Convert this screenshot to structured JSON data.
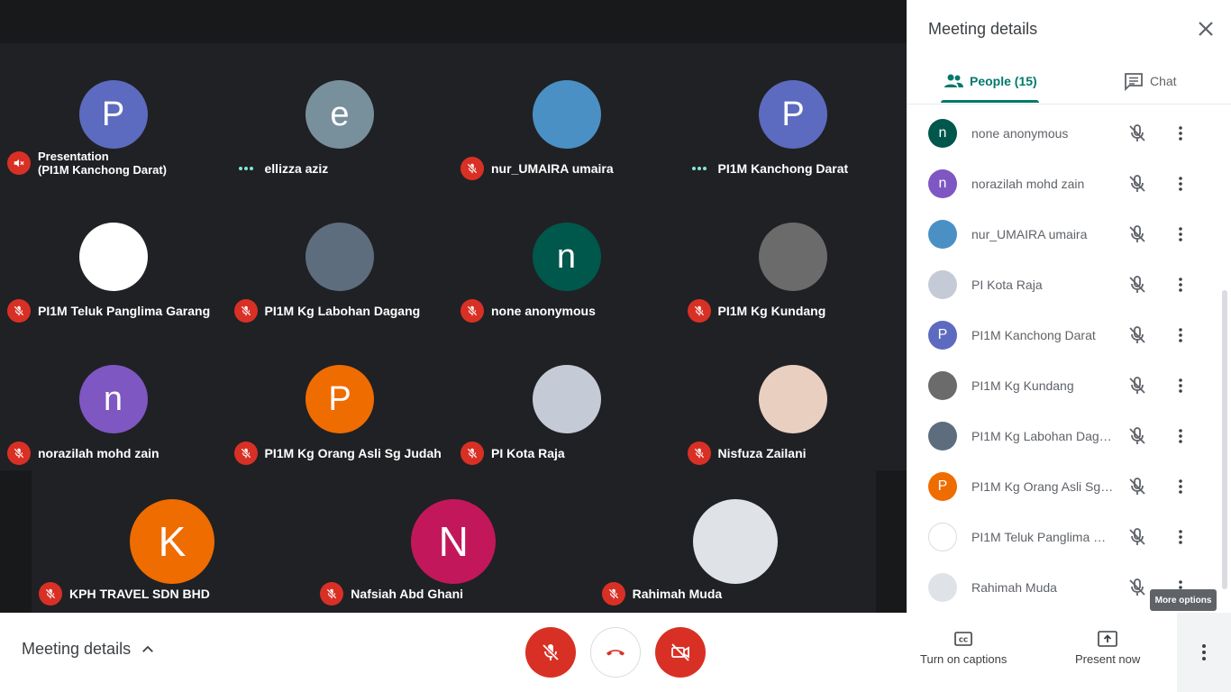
{
  "grid": {
    "tiles": [
      {
        "name": "Presentation\n(PI1M Kanchong Darat)",
        "initial": "P",
        "color": "#5c6bc0",
        "status": "speaker-off"
      },
      {
        "name": "ellizza aziz",
        "initial": "e",
        "color": "#78909c",
        "status": "dots"
      },
      {
        "name": "nur_UMAIRA umaira",
        "initial": "",
        "color": "#4a90c4",
        "status": "mic-off"
      },
      {
        "name": "PI1M Kanchong Darat",
        "initial": "P",
        "color": "#5c6bc0",
        "status": "dots"
      },
      {
        "name": "PI1M Teluk Panglima Garang",
        "initial": "",
        "color": "#ffffff",
        "status": "mic-off"
      },
      {
        "name": "PI1M Kg Labohan Dagang",
        "initial": "",
        "color": "#5d6d7e",
        "status": "mic-off"
      },
      {
        "name": "none anonymous",
        "initial": "n",
        "color": "#00574b",
        "status": "mic-off"
      },
      {
        "name": "PI1M Kg Kundang",
        "initial": "",
        "color": "#6b6b6b",
        "status": "mic-off"
      },
      {
        "name": "norazilah mohd zain",
        "initial": "n",
        "color": "#7e57c2",
        "status": "mic-off"
      },
      {
        "name": "PI1M Kg Orang Asli Sg Judah",
        "initial": "P",
        "color": "#ef6c00",
        "status": "mic-off"
      },
      {
        "name": "PI Kota Raja",
        "initial": "",
        "color": "#c5cbd6",
        "status": "mic-off"
      },
      {
        "name": "Nisfuza Zailani",
        "initial": "",
        "color": "#e8cfc0",
        "status": "mic-off"
      }
    ],
    "bottom": [
      {
        "name": "KPH TRAVEL SDN BHD",
        "initial": "K",
        "color": "#ef6c00"
      },
      {
        "name": "Nafsiah Abd Ghani",
        "initial": "N",
        "color": "#c2185b"
      },
      {
        "name": "Rahimah Muda",
        "initial": "",
        "color": "#dfe3e8"
      }
    ]
  },
  "panel": {
    "title": "Meeting details",
    "tab_people": "People (15)",
    "tab_chat": "Chat",
    "people": [
      {
        "name": "none anonymous",
        "initial": "n",
        "color": "#00574b"
      },
      {
        "name": "norazilah mohd zain",
        "initial": "n",
        "color": "#7e57c2"
      },
      {
        "name": "nur_UMAIRA umaira",
        "initial": "",
        "color": "#4a90c4"
      },
      {
        "name": "PI Kota Raja",
        "initial": "",
        "color": "#c5cbd6"
      },
      {
        "name": "PI1M Kanchong Darat",
        "initial": "P",
        "color": "#5c6bc0"
      },
      {
        "name": "PI1M Kg Kundang",
        "initial": "",
        "color": "#6b6b6b"
      },
      {
        "name": "PI1M Kg Labohan Dagang",
        "initial": "",
        "color": "#5d6d7e"
      },
      {
        "name": "PI1M Kg Orang Asli Sg J...",
        "initial": "P",
        "color": "#ef6c00"
      },
      {
        "name": "PI1M Teluk Panglima Ga...",
        "initial": "",
        "color": "#ffffff"
      },
      {
        "name": "Rahimah Muda",
        "initial": "",
        "color": "#dfe3e8"
      }
    ],
    "tooltip": "More options"
  },
  "bar": {
    "meeting_details": "Meeting details",
    "captions": "Turn on captions",
    "present": "Present now"
  },
  "colors": {
    "accent": "#00796b",
    "danger": "#d93025"
  }
}
